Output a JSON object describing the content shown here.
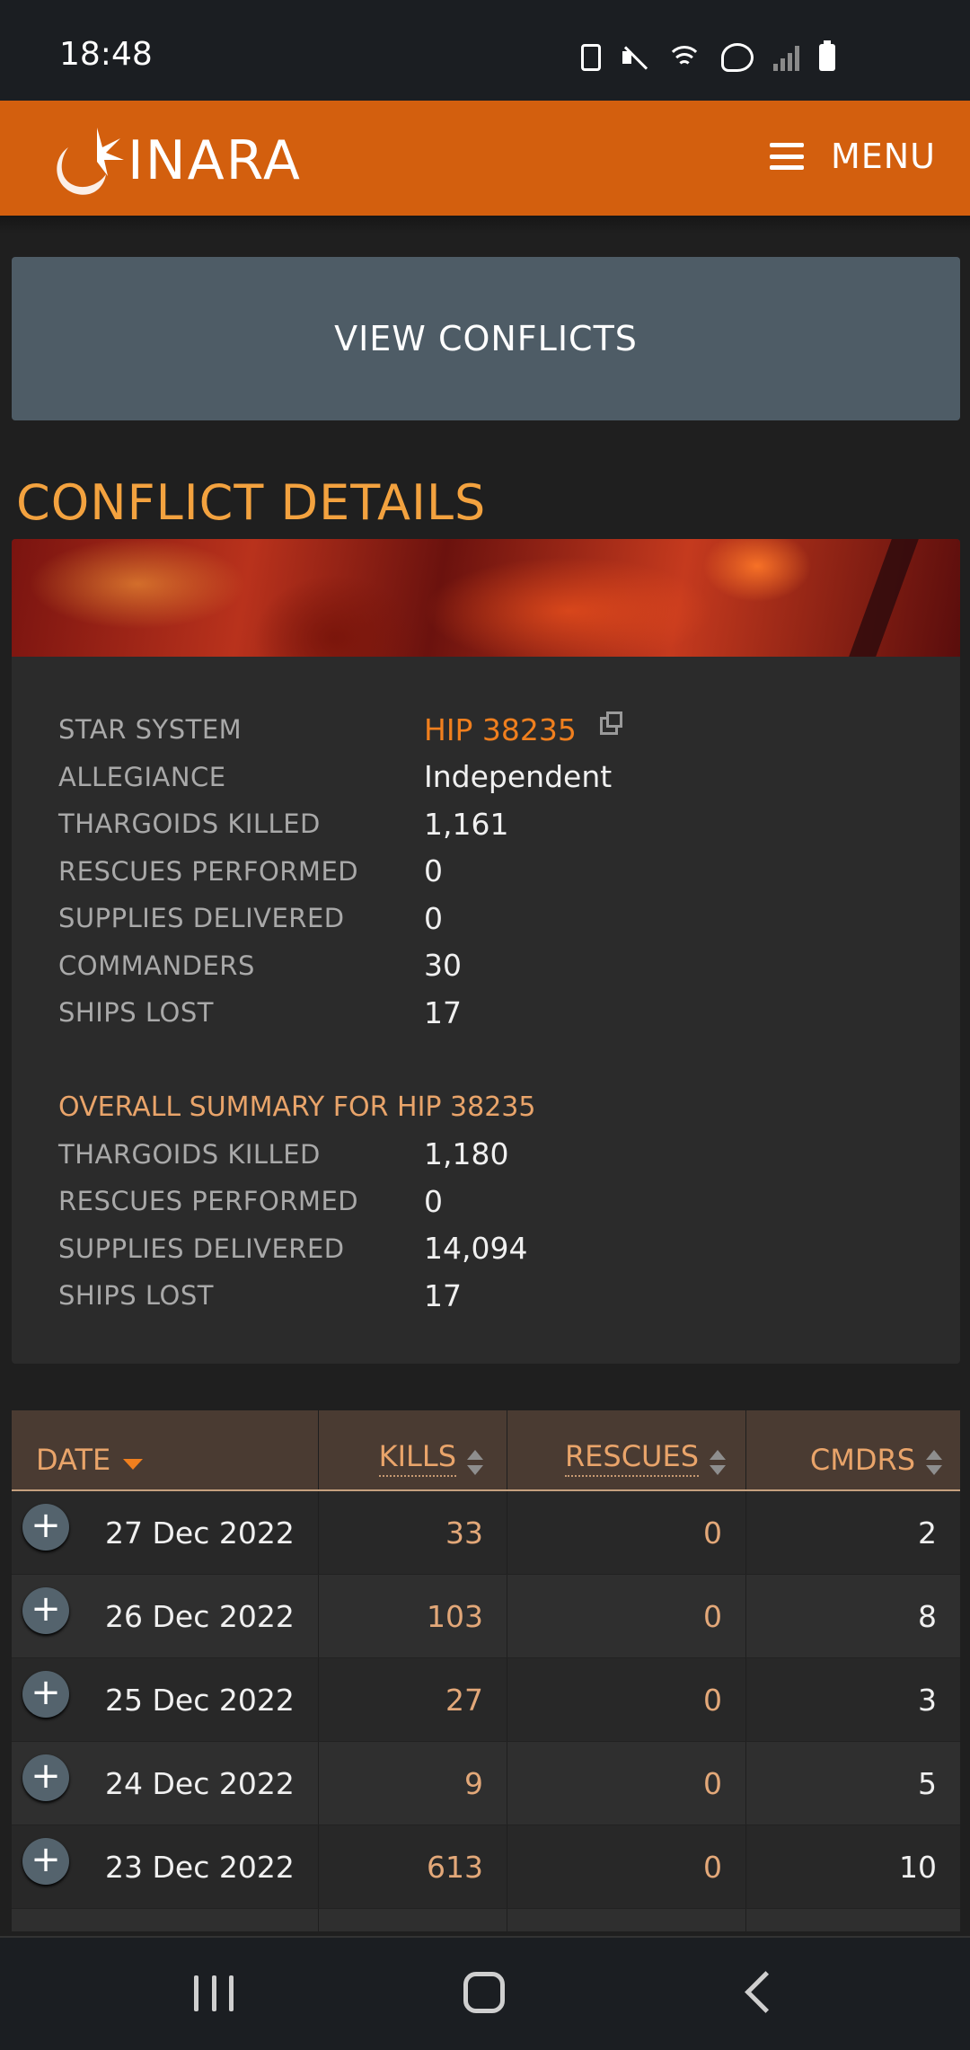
{
  "status_bar": {
    "time": "18:48",
    "icons": [
      "battery-saver-icon",
      "mute-icon",
      "wifi-icon",
      "wifi-calling-icon",
      "signal-icon",
      "battery-icon"
    ]
  },
  "header": {
    "logo_text": "INARA",
    "menu_label": "MENU",
    "brand_color": "#d35f0e"
  },
  "view_conflicts_label": "VIEW CONFLICTS",
  "section_title": "CONFLICT DETAILS",
  "details": {
    "star_system_label": "STAR SYSTEM",
    "star_system_value": "HIP 38235",
    "allegiance_label": "ALLEGIANCE",
    "allegiance_value": "Independent",
    "thargoids_killed_label": "THARGOIDS KILLED",
    "thargoids_killed_value": "1,161",
    "rescues_label": "RESCUES PERFORMED",
    "rescues_value": "0",
    "supplies_label": "SUPPLIES DELIVERED",
    "supplies_value": "0",
    "commanders_label": "COMMANDERS",
    "commanders_value": "30",
    "ships_lost_label": "SHIPS LOST",
    "ships_lost_value": "17"
  },
  "summary": {
    "title": "OVERALL SUMMARY FOR HIP 38235",
    "thargoids_killed_label": "THARGOIDS KILLED",
    "thargoids_killed_value": "1,180",
    "rescues_label": "RESCUES PERFORMED",
    "rescues_value": "0",
    "supplies_label": "SUPPLIES DELIVERED",
    "supplies_value": "14,094",
    "ships_lost_label": "SHIPS LOST",
    "ships_lost_value": "17"
  },
  "table": {
    "headers": {
      "date": "DATE",
      "kills": "KILLS",
      "rescues": "RESCUES",
      "cmdrs": "CMDRS"
    },
    "rows": [
      {
        "date": "27 Dec 2022",
        "kills": "33",
        "rescues": "0",
        "cmdrs": "2"
      },
      {
        "date": "26 Dec 2022",
        "kills": "103",
        "rescues": "0",
        "cmdrs": "8"
      },
      {
        "date": "25 Dec 2022",
        "kills": "27",
        "rescues": "0",
        "cmdrs": "3"
      },
      {
        "date": "24 Dec 2022",
        "kills": "9",
        "rescues": "0",
        "cmdrs": "5"
      },
      {
        "date": "23 Dec 2022",
        "kills": "613",
        "rescues": "0",
        "cmdrs": "10"
      }
    ]
  }
}
